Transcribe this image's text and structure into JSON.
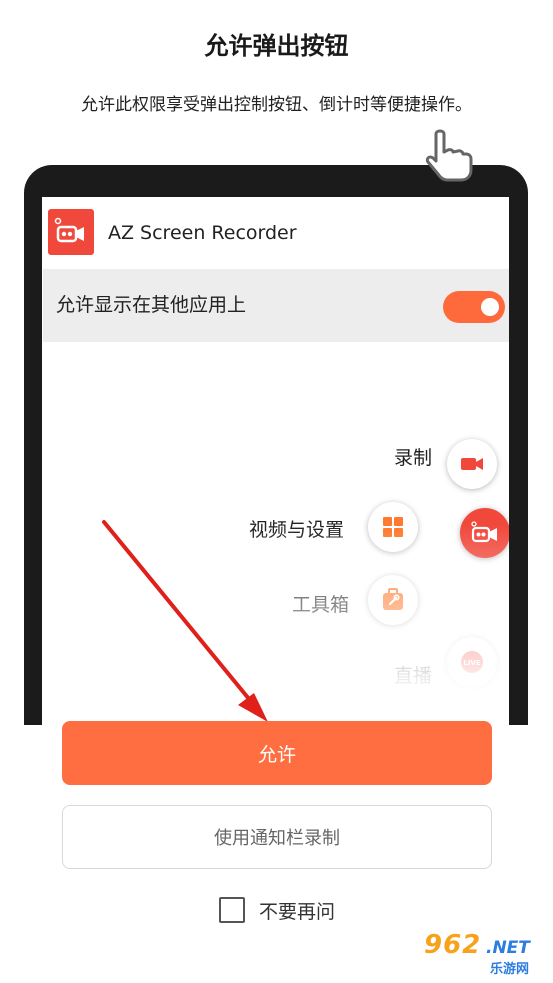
{
  "header": {
    "title": "允许弹出按钮",
    "subtitle": "允许此权限享受弹出控制按钮、倒计时等便捷操作。"
  },
  "phone_mockup": {
    "app_name": "AZ Screen Recorder",
    "permission_label": "允许显示在其他应用上",
    "toggle_on": true,
    "menu_items": [
      {
        "label": "录制",
        "icon": "record-icon"
      },
      {
        "label": "视频与设置",
        "icon": "grid-icon"
      },
      {
        "label": "工具箱",
        "icon": "toolbox-icon"
      },
      {
        "label": "直播",
        "icon": "live-icon",
        "badge": "LIVE"
      }
    ],
    "fab_icon": "camera-icon"
  },
  "actions": {
    "allow_label": "允许",
    "notification_label": "使用通知栏录制",
    "dont_ask_label": "不要再问",
    "dont_ask_checked": false
  },
  "watermark": {
    "number": "962",
    "suffix": ".NET",
    "cn": "乐游网"
  },
  "colors": {
    "accent": "#ff6e41",
    "brand_red": "#f1483c",
    "arrow_red": "#e0201b"
  }
}
